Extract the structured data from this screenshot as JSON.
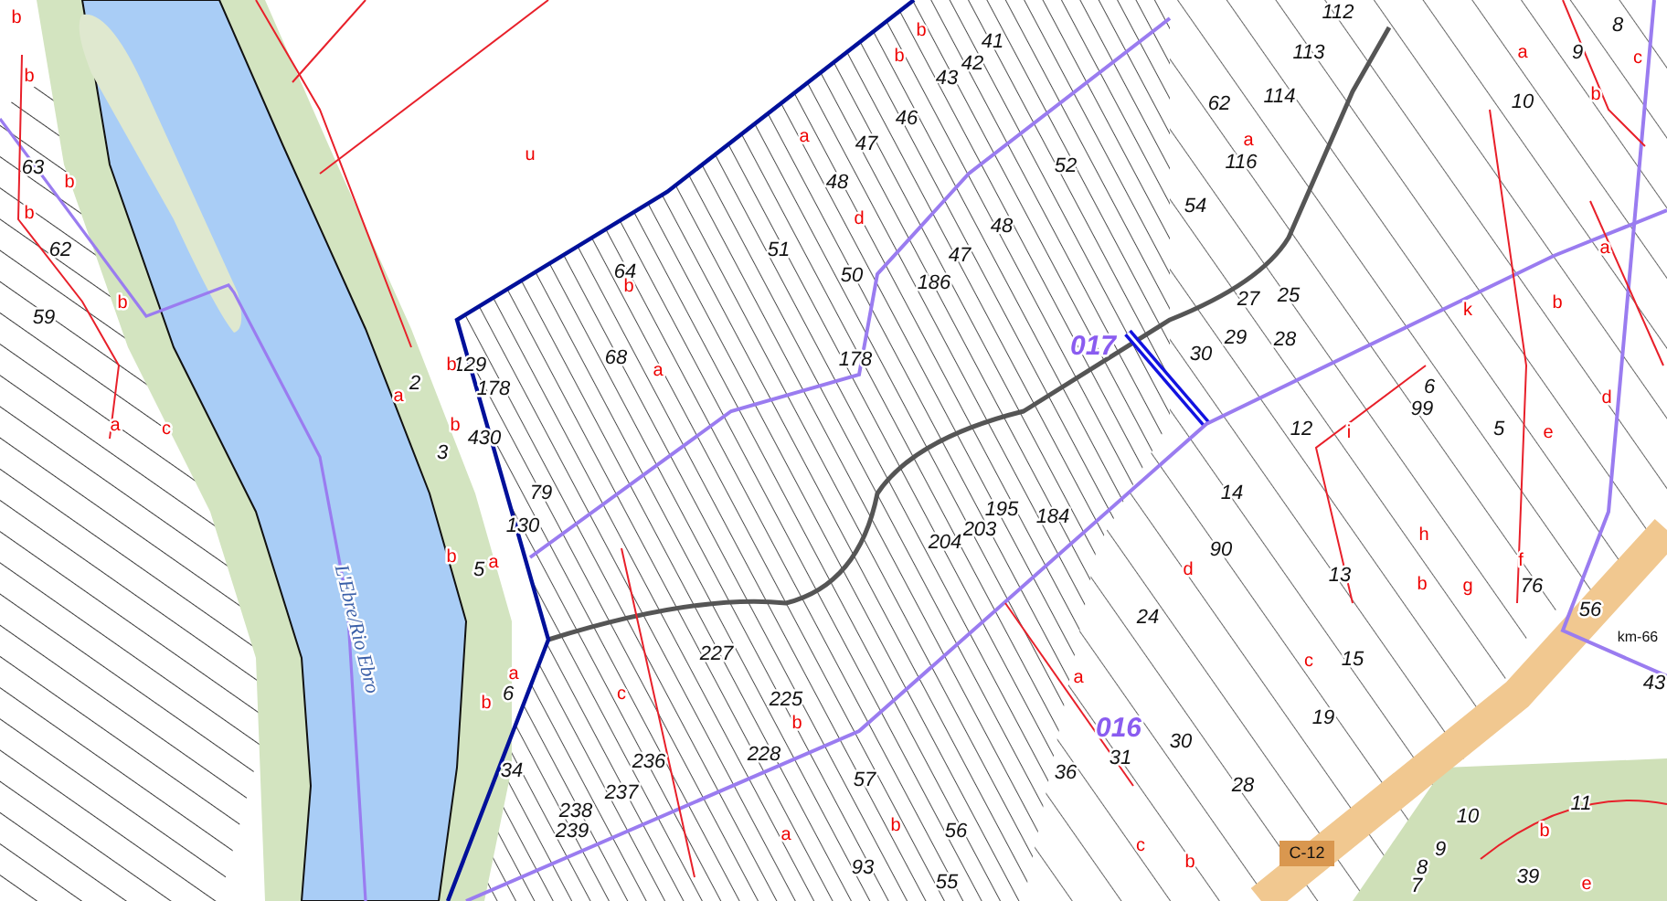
{
  "map": {
    "river": {
      "name": "L'Ebre/Rio Ebro"
    },
    "zones": [
      {
        "code": "017"
      },
      {
        "code": "016"
      }
    ],
    "road_badge": "C-12",
    "km_marker": "km-66",
    "parcels": [
      {
        "number": "63"
      },
      {
        "number": "62"
      },
      {
        "number": "59"
      },
      {
        "number": "2"
      },
      {
        "number": "129"
      },
      {
        "number": "178"
      },
      {
        "number": "3"
      },
      {
        "number": "430"
      },
      {
        "number": "79"
      },
      {
        "number": "130"
      },
      {
        "number": "5"
      },
      {
        "number": "6"
      },
      {
        "number": "34"
      },
      {
        "number": "47"
      },
      {
        "number": "46"
      },
      {
        "number": "48"
      },
      {
        "number": "51"
      },
      {
        "number": "50"
      },
      {
        "number": "186"
      },
      {
        "number": "47"
      },
      {
        "number": "48"
      },
      {
        "number": "52"
      },
      {
        "number": "41"
      },
      {
        "number": "42"
      },
      {
        "number": "43"
      },
      {
        "number": "64"
      },
      {
        "number": "68"
      },
      {
        "number": "178"
      },
      {
        "number": "112"
      },
      {
        "number": "113"
      },
      {
        "number": "114"
      },
      {
        "number": "62"
      },
      {
        "number": "116"
      },
      {
        "number": "54"
      },
      {
        "number": "27"
      },
      {
        "number": "29"
      },
      {
        "number": "28"
      },
      {
        "number": "30"
      },
      {
        "number": "25"
      },
      {
        "number": "12"
      },
      {
        "number": "8"
      },
      {
        "number": "9"
      },
      {
        "number": "10"
      },
      {
        "number": "6"
      },
      {
        "number": "99"
      },
      {
        "number": "5"
      },
      {
        "number": "14"
      },
      {
        "number": "90"
      },
      {
        "number": "13"
      },
      {
        "number": "15"
      },
      {
        "number": "19"
      },
      {
        "number": "24"
      },
      {
        "number": "28"
      },
      {
        "number": "30"
      },
      {
        "number": "31"
      },
      {
        "number": "36"
      },
      {
        "number": "56"
      },
      {
        "number": "57"
      },
      {
        "number": "55"
      },
      {
        "number": "93"
      },
      {
        "number": "236"
      },
      {
        "number": "237"
      },
      {
        "number": "238"
      },
      {
        "number": "239"
      },
      {
        "number": "228"
      },
      {
        "number": "227"
      },
      {
        "number": "225"
      },
      {
        "number": "203"
      },
      {
        "number": "195"
      },
      {
        "number": "184"
      },
      {
        "number": "204"
      },
      {
        "number": "76"
      },
      {
        "number": "56"
      },
      {
        "number": "43"
      },
      {
        "number": "11"
      },
      {
        "number": "10"
      },
      {
        "number": "9"
      },
      {
        "number": "8"
      },
      {
        "number": "39"
      },
      {
        "number": "7"
      }
    ],
    "subparcels": [
      {
        "letter": "u"
      },
      {
        "letter": "a"
      },
      {
        "letter": "d"
      },
      {
        "letter": "b"
      },
      {
        "letter": "b"
      },
      {
        "letter": "b"
      },
      {
        "letter": "a"
      },
      {
        "letter": "c"
      },
      {
        "letter": "a"
      },
      {
        "letter": "b"
      },
      {
        "letter": "a"
      },
      {
        "letter": "k"
      },
      {
        "letter": "b"
      },
      {
        "letter": "a"
      },
      {
        "letter": "i"
      },
      {
        "letter": "h"
      },
      {
        "letter": "f"
      },
      {
        "letter": "g"
      },
      {
        "letter": "b"
      },
      {
        "letter": "d"
      },
      {
        "letter": "c"
      },
      {
        "letter": "c"
      },
      {
        "letter": "b"
      },
      {
        "letter": "e"
      },
      {
        "letter": "b"
      },
      {
        "letter": "b"
      },
      {
        "letter": "b"
      },
      {
        "letter": "b"
      },
      {
        "letter": "b"
      },
      {
        "letter": "b"
      },
      {
        "letter": "a"
      },
      {
        "letter": "c"
      },
      {
        "letter": "b"
      },
      {
        "letter": "a"
      },
      {
        "letter": "b"
      },
      {
        "letter": "a"
      },
      {
        "letter": "b"
      },
      {
        "letter": "b"
      },
      {
        "letter": "a"
      },
      {
        "letter": "a"
      },
      {
        "letter": "b"
      },
      {
        "letter": "b"
      },
      {
        "letter": "c"
      },
      {
        "letter": "a"
      },
      {
        "letter": "e"
      },
      {
        "letter": "d"
      }
    ]
  }
}
